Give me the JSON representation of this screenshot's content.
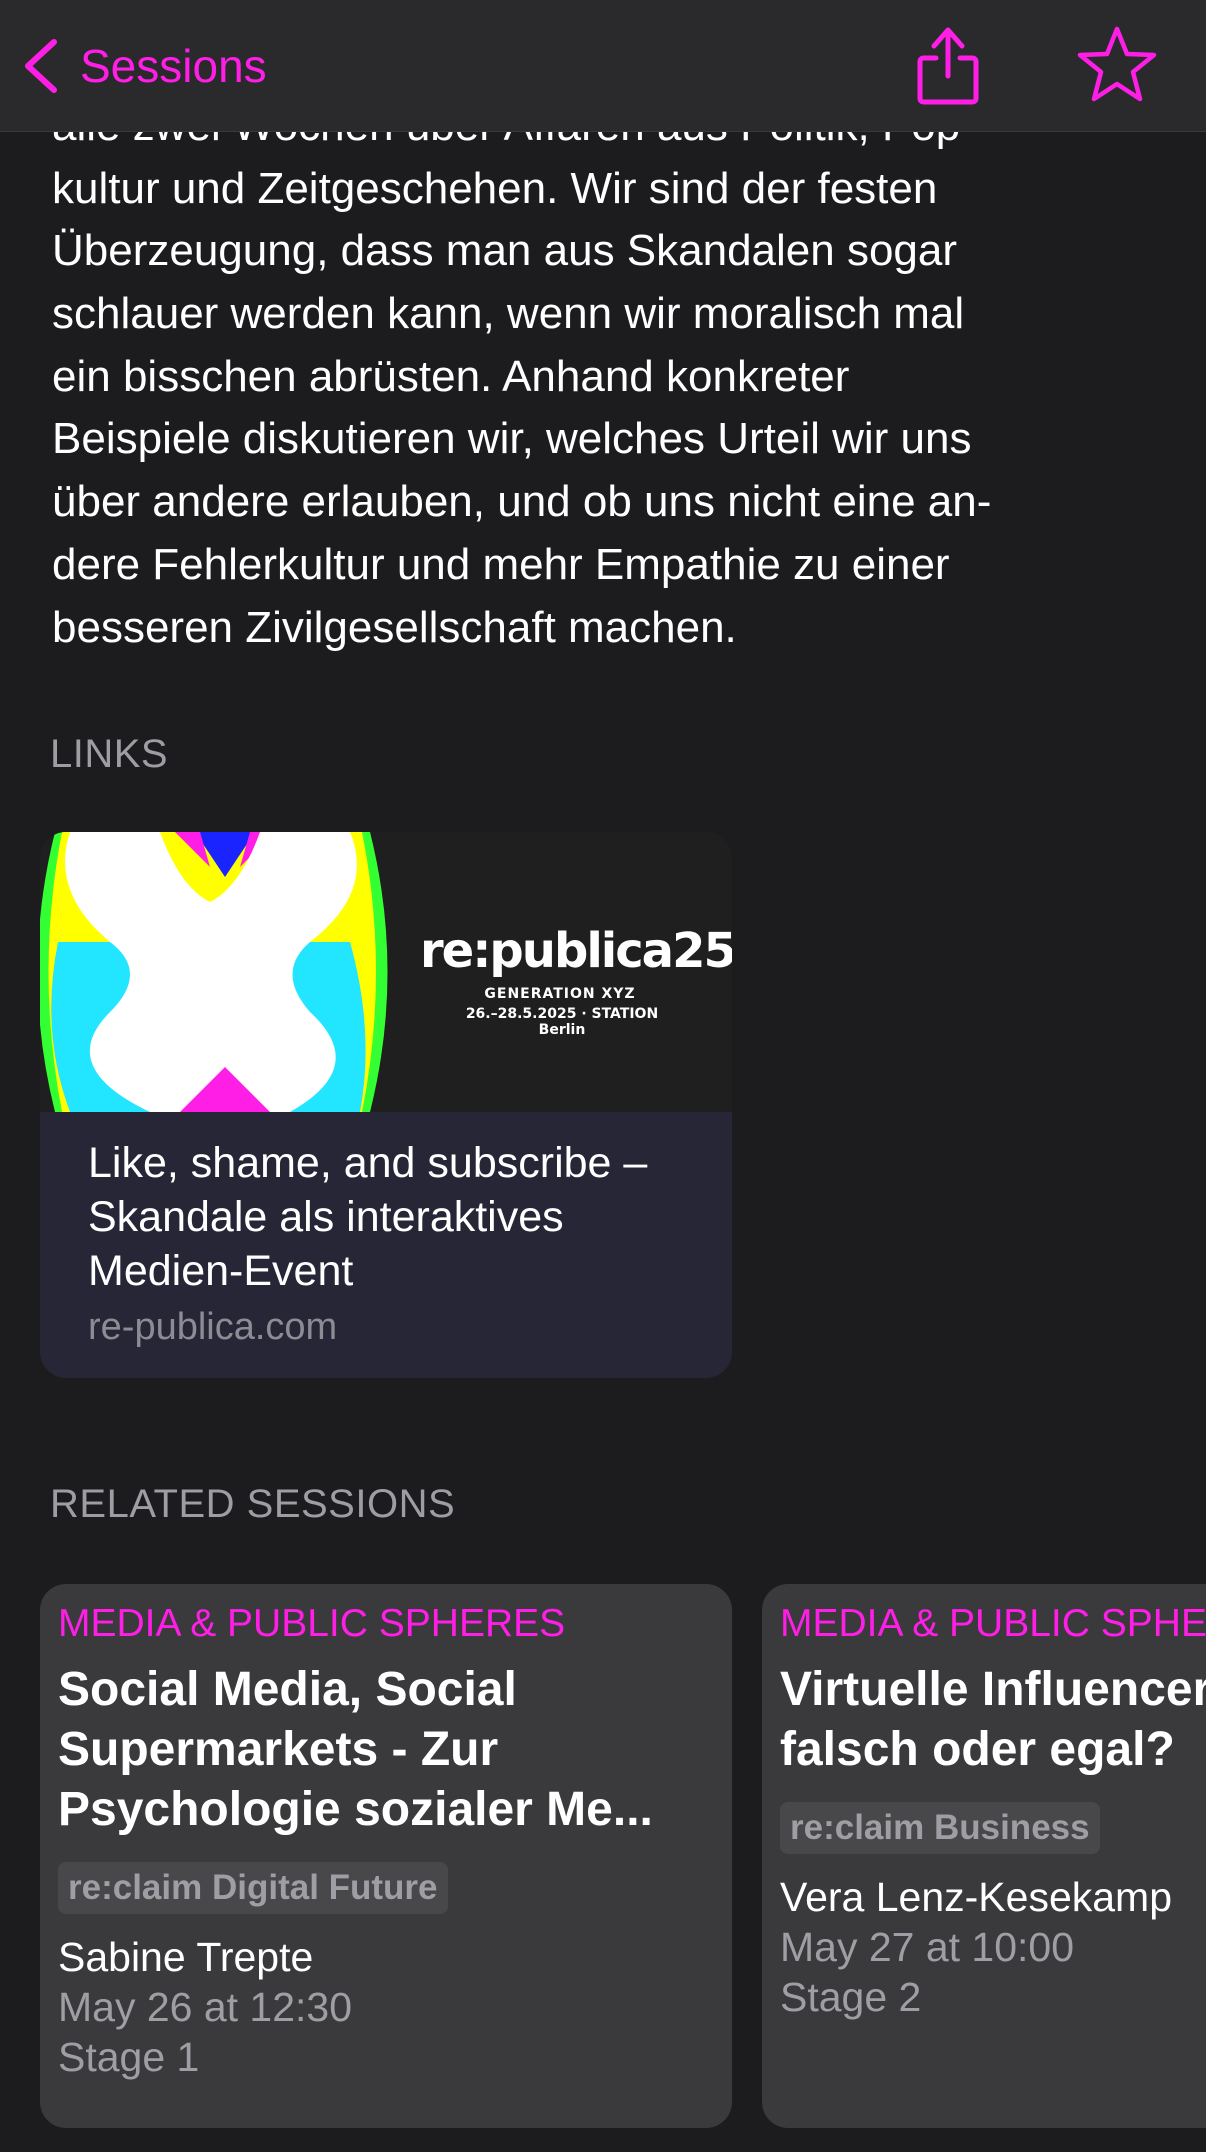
{
  "nav": {
    "back_label": "Sessions",
    "accent_color": "#ff1ee6",
    "icons": [
      "chevron-left-icon",
      "share-icon",
      "star-icon"
    ]
  },
  "description": {
    "lines": [
      "alle zwei Wochen über Affären aus Politik, Pop-",
      "kultur und Zeitgeschehen. Wir sind der festen",
      "Überzeugung, dass man aus Skandalen sogar",
      "schlauer werden kann, wenn wir moralisch mal",
      "ein bisschen abrüsten. Anhand konkreter",
      "Beispiele diskutieren wir, welches Urteil wir uns",
      "über andere erlauben, und ob uns nicht eine an-",
      "dere Fehlerkultur und mehr Empathie zu einer",
      "besseren Zivilgesellschaft machen."
    ]
  },
  "links": {
    "header": "LINKS",
    "card": {
      "brand_name": "re:publica25",
      "brand_subtitle": "GENERATION XYZ",
      "brand_date": "26.–28.5.2025 · STATION Berlin",
      "title": "Like, shame, and subscribe – Skandale als interaktives Medien-Event",
      "domain": "re-publica.com"
    }
  },
  "related": {
    "header": "RELATED SESSIONS",
    "sessions": [
      {
        "track": "MEDIA & PUBLIC SPHERES",
        "title_lines": [
          "Social Media, Social",
          "Supermarkets - Zur",
          "Psychologie sozialer Me..."
        ],
        "tag": "re:claim Digital Future",
        "speaker": "Sabine Trepte",
        "time": "May 26 at 12:30",
        "stage": "Stage 1"
      },
      {
        "track": "MEDIA & PUBLIC SPHERES",
        "title_lines": [
          "Virtuelle Influencer:",
          "falsch oder egal?"
        ],
        "tag": "re:claim Business",
        "speaker": "Vera Lenz-Kesekamp",
        "time": "May 27 at 10:00",
        "stage": "Stage 2"
      }
    ]
  }
}
